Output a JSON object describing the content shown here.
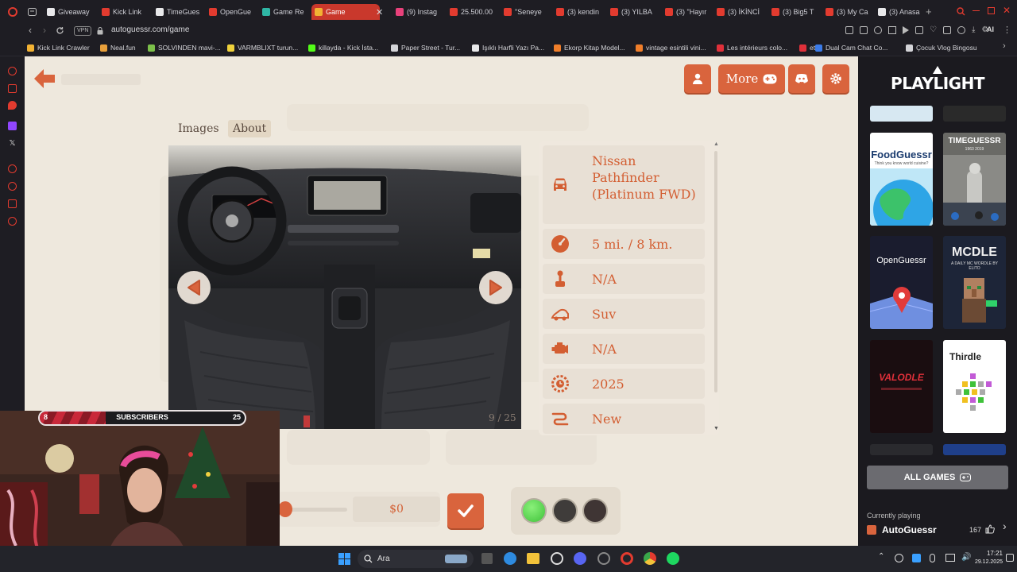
{
  "browser": {
    "tabs": [
      {
        "label": "Giveaway",
        "color": "#e8e8ea"
      },
      {
        "label": "Kick Link",
        "color": "#e23b2f"
      },
      {
        "label": "TimeGues",
        "color": "#e8e8ea"
      },
      {
        "label": "OpenGue",
        "color": "#e23b2f"
      },
      {
        "label": "Game Re",
        "color": "#2fb6a5"
      },
      {
        "label": "Game",
        "color": "#f2b233",
        "active": true
      },
      {
        "label": "(9) Instag",
        "color": "#e8417b"
      },
      {
        "label": "25.500.00",
        "color": "#e23b2f"
      },
      {
        "label": "\"Seneye",
        "color": "#e23b2f"
      },
      {
        "label": "(3) kendin",
        "color": "#e23b2f"
      },
      {
        "label": "(3) YILBA",
        "color": "#e23b2f"
      },
      {
        "label": "(3) \"Hayır",
        "color": "#e23b2f"
      },
      {
        "label": "(3) İKİNCİ",
        "color": "#e23b2f"
      },
      {
        "label": "(3) Big5 T",
        "color": "#e23b2f"
      },
      {
        "label": "(3) My Ca",
        "color": "#e23b2f"
      },
      {
        "label": "(3) Anasa",
        "color": "#e8e8ea"
      }
    ],
    "vpn_label": "VPN",
    "url": "autoguessr.com/game",
    "ai_label": "AI",
    "bookmarks": [
      {
        "label": "Kick Link Crawler",
        "color": "#f2b233"
      },
      {
        "label": "Neal.fun",
        "color": "#e8a03b"
      },
      {
        "label": "SOLVINDEN mavi-...",
        "color": "#7cc04a"
      },
      {
        "label": "VARMBLIXT turun...",
        "color": "#f0d23b"
      },
      {
        "label": "killayda - Kick İsta...",
        "color": "#53fc18"
      },
      {
        "label": "Paper Street - Tur...",
        "color": "#d4d4d8"
      },
      {
        "label": "Işıklı Harfli Yazı Pa...",
        "color": "#e8e8ea"
      },
      {
        "label": "Ekorp Kitap Model...",
        "color": "#f07e2a"
      },
      {
        "label": "vintage esintili vini...",
        "color": "#f07e2a"
      },
      {
        "label": "Les intérieurs colo...",
        "color": "#e0303a"
      },
      {
        "label": "et",
        "color": "#e0303a"
      },
      {
        "label": "Dual Cam Chat Co...",
        "color": "#3b7be8"
      },
      {
        "label": "Çocuk Vlog Bingosu",
        "color": "#d4d4d8"
      }
    ]
  },
  "game": {
    "more_label": "More",
    "tab_images": "Images",
    "tab_about": "About",
    "photo_counter": "9 / 25",
    "details": [
      {
        "icon": "car-icon",
        "value": "Nissan Pathfinder (Platinum FWD)"
      },
      {
        "icon": "odometer-icon",
        "value": "5 mi. / 8 km."
      },
      {
        "icon": "gear-shift-icon",
        "value": "N/A"
      },
      {
        "icon": "body-type-icon",
        "value": "Suv"
      },
      {
        "icon": "engine-icon",
        "value": "N/A"
      },
      {
        "icon": "calendar-icon",
        "value": "2025"
      },
      {
        "icon": "condition-icon",
        "value": "New"
      }
    ],
    "price_value": "$0",
    "accent": "#d9643d"
  },
  "sidebar": {
    "brand": "PLAYLIGHT",
    "games": [
      {
        "name": "FoodGuessr",
        "subtitle": "Think you know world cuisine?"
      },
      {
        "name": "TIMEGUESSR",
        "subtitle": "1963  2019"
      },
      {
        "name": "OpenGuessr",
        "subtitle": ""
      },
      {
        "name": "MCDLE",
        "subtitle": "A DAILY MC WORDLE BY ELITO"
      },
      {
        "name": "VALODLE",
        "subtitle": ""
      },
      {
        "name": "Thirdle",
        "subtitle": ""
      }
    ],
    "all_games_label": "ALL GAMES",
    "currently_playing_label": "Currently playing",
    "current_game": "AutoGuessr",
    "likes": "167"
  },
  "stream": {
    "subscribers_label": "SUBSCRIBERS",
    "sub_current": "8",
    "sub_goal": "25",
    "sub_progress": 0.32
  },
  "taskbar": {
    "search_label": "Ara",
    "time": "17:21",
    "date": "29.12.2025"
  }
}
